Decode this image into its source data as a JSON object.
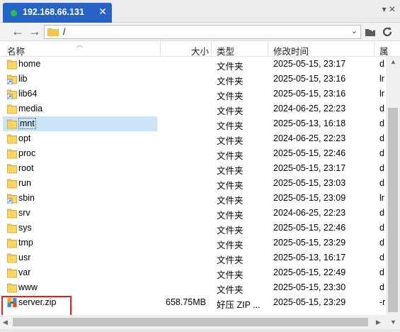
{
  "tab": {
    "title": "192.168.66.131",
    "close": "✕"
  },
  "tabbar": {
    "menu_glyph": "▾ ✕"
  },
  "toolbar": {
    "back": "←",
    "forward": "→",
    "path": "/",
    "dropdown": "⌄"
  },
  "columns": {
    "name": "名称",
    "size": "大小",
    "type": "类型",
    "modified": "修改时间",
    "perm": "属"
  },
  "files": [
    {
      "name": "home",
      "size": "",
      "type": "文件夹",
      "modified": "2025-05-15, 23:17",
      "perm": "d",
      "icon": "folder-icon"
    },
    {
      "name": "lib",
      "size": "",
      "type": "文件夹",
      "modified": "2025-05-15, 23:16",
      "perm": "lr",
      "icon": "folder-link-icon"
    },
    {
      "name": "lib64",
      "size": "",
      "type": "文件夹",
      "modified": "2025-05-15, 23:16",
      "perm": "lr",
      "icon": "folder-link-icon"
    },
    {
      "name": "media",
      "size": "",
      "type": "文件夹",
      "modified": "2024-06-25, 22:23",
      "perm": "d",
      "icon": "folder-icon"
    },
    {
      "name": "mnt",
      "size": "",
      "type": "文件夹",
      "modified": "2025-05-13, 16:18",
      "perm": "d",
      "icon": "folder-icon"
    },
    {
      "name": "opt",
      "size": "",
      "type": "文件夹",
      "modified": "2024-06-25, 22:23",
      "perm": "d",
      "icon": "folder-icon"
    },
    {
      "name": "proc",
      "size": "",
      "type": "文件夹",
      "modified": "2025-05-15, 22:46",
      "perm": "d",
      "icon": "folder-icon"
    },
    {
      "name": "root",
      "size": "",
      "type": "文件夹",
      "modified": "2025-05-15, 23:17",
      "perm": "d",
      "icon": "folder-icon"
    },
    {
      "name": "run",
      "size": "",
      "type": "文件夹",
      "modified": "2025-05-15, 23:03",
      "perm": "d",
      "icon": "folder-icon"
    },
    {
      "name": "sbin",
      "size": "",
      "type": "文件夹",
      "modified": "2025-05-15, 23:09",
      "perm": "lr",
      "icon": "folder-link-icon"
    },
    {
      "name": "srv",
      "size": "",
      "type": "文件夹",
      "modified": "2024-06-25, 22:23",
      "perm": "d",
      "icon": "folder-icon"
    },
    {
      "name": "sys",
      "size": "",
      "type": "文件夹",
      "modified": "2025-05-15, 22:46",
      "perm": "d",
      "icon": "folder-icon"
    },
    {
      "name": "tmp",
      "size": "",
      "type": "文件夹",
      "modified": "2025-05-15, 23:29",
      "perm": "d",
      "icon": "folder-icon"
    },
    {
      "name": "usr",
      "size": "",
      "type": "文件夹",
      "modified": "2025-05-13, 16:17",
      "perm": "d",
      "icon": "folder-icon"
    },
    {
      "name": "var",
      "size": "",
      "type": "文件夹",
      "modified": "2025-05-15, 22:49",
      "perm": "d",
      "icon": "folder-icon"
    },
    {
      "name": "www",
      "size": "",
      "type": "文件夹",
      "modified": "2025-05-15, 23:30",
      "perm": "d",
      "icon": "folder-icon"
    },
    {
      "name": "server.zip",
      "size": "658.75MB",
      "type": "好压 ZIP ...",
      "modified": "2025-05-15, 23:29",
      "perm": "-r",
      "icon": "zip-archive-icon"
    }
  ],
  "selected_index": 4,
  "colors": {
    "tab": "#2563c6",
    "status_dot": "#23c33f",
    "folder": "#f5c84c",
    "selection": "#cce4f7",
    "highlight": "#e02020"
  }
}
